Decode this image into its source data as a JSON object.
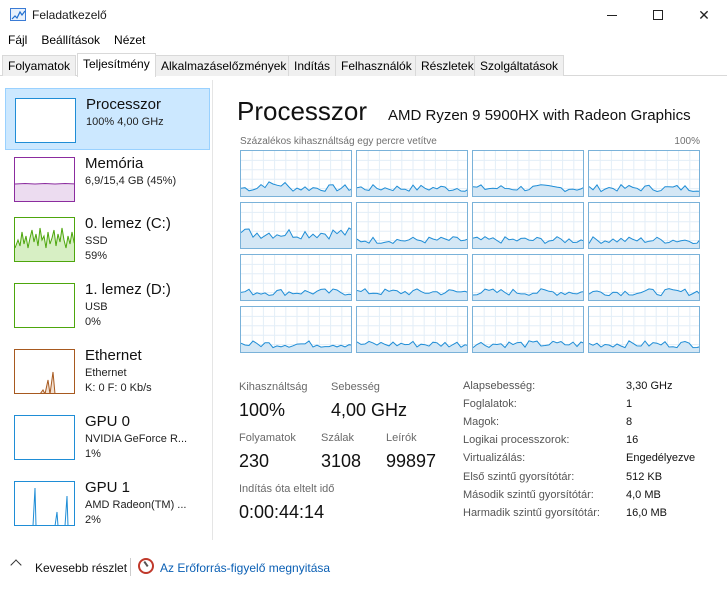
{
  "window": {
    "title": "Feladatkezelő",
    "icon": "task-manager-icon"
  },
  "menu": [
    "Fájl",
    "Beállítások",
    "Nézet"
  ],
  "tabs": [
    {
      "label": "Folyamatok",
      "active": false
    },
    {
      "label": "Teljesítmény",
      "active": true
    },
    {
      "label": "Alkalmazáselőzmények",
      "active": false
    },
    {
      "label": "Indítás",
      "active": false
    },
    {
      "label": "Felhasználók",
      "active": false
    },
    {
      "label": "Részletek",
      "active": false
    },
    {
      "label": "Szolgáltatások",
      "active": false
    }
  ],
  "sidebar": {
    "items": [
      {
        "name": "Processzor",
        "sub1": "100% 4,00 GHz",
        "sub2": "",
        "color": "#1f8dd6",
        "selected": true
      },
      {
        "name": "Memória",
        "sub1": "6,9/15,4 GB (45%)",
        "sub2": "",
        "color": "#8b2c9f",
        "selected": false
      },
      {
        "name": "0. lemez (C:)",
        "sub1": "SSD",
        "sub2": "59%",
        "color": "#4da60c",
        "selected": false
      },
      {
        "name": "1. lemez (D:)",
        "sub1": "USB",
        "sub2": "0%",
        "color": "#4da60c",
        "selected": false
      },
      {
        "name": "Ethernet",
        "sub1": "Ethernet",
        "sub2": "K: 0 F: 0 Kb/s",
        "color": "#a7591f",
        "selected": false
      },
      {
        "name": "GPU 0",
        "sub1": "NVIDIA GeForce R...",
        "sub2": "1%",
        "color": "#1f8dd6",
        "selected": false
      },
      {
        "name": "GPU 1",
        "sub1": "AMD Radeon(TM) ...",
        "sub2": "2%",
        "color": "#1f8dd6",
        "selected": false
      }
    ]
  },
  "main": {
    "title": "Processzor",
    "model": "AMD Ryzen 9 5900HX with Radeon Graphics",
    "graph_caption": "Százalékos kihasználtság egy percre vetítve",
    "graph_max": "100%",
    "stats": {
      "usage_label": "Kihasználtság",
      "usage_value": "100%",
      "speed_label": "Sebesség",
      "speed_value": "4,00 GHz",
      "processes_label": "Folyamatok",
      "processes_value": "230",
      "threads_label": "Szálak",
      "threads_value": "3108",
      "handles_label": "Leírók",
      "handles_value": "99897",
      "uptime_label": "Indítás óta eltelt idő",
      "uptime_value": "0:00:44:14"
    },
    "props": [
      {
        "label": "Alapsebesség:",
        "value": "3,30 GHz"
      },
      {
        "label": "Foglalatok:",
        "value": "1"
      },
      {
        "label": "Magok:",
        "value": "8"
      },
      {
        "label": "Logikai processzorok:",
        "value": "16"
      },
      {
        "label": "Virtualizálás:",
        "value": "Engedélyezve"
      },
      {
        "label": "Első szintű gyorsítótár:",
        "value": "512 KB"
      },
      {
        "label": "Második szintű gyorsítótár:",
        "value": "4,0 MB"
      },
      {
        "label": "Harmadik szintű gyorsítótár:",
        "value": "16,0 MB"
      }
    ]
  },
  "footer": {
    "fewer_details": "Kevesebb részlet",
    "resource_monitor": "Az Erőforrás-figyelő megnyitása"
  },
  "colors": {
    "cpu": "#1f8dd6",
    "cpu_fill": "#d4e7f5",
    "memory": "#8b2c9f",
    "disk": "#4da60c",
    "ethernet": "#a7591f",
    "link": "#0a5fb4"
  }
}
